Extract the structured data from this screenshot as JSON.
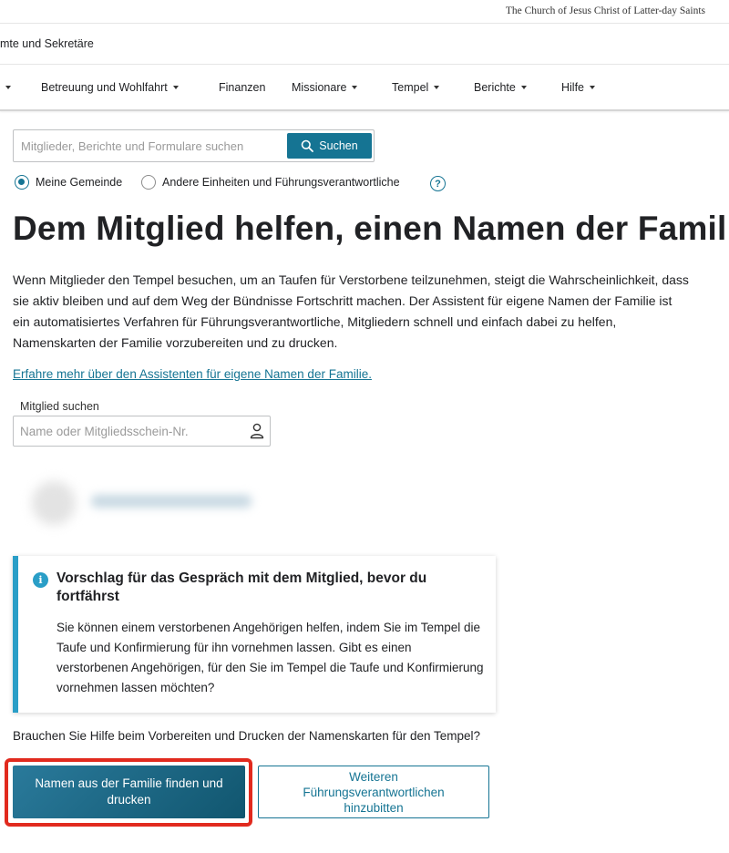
{
  "brand": "The Church of Jesus Christ of Latter-day Saints",
  "subheader": "mte und Sekretäre",
  "nav": {
    "items": [
      {
        "label": "",
        "has_caret": true
      },
      {
        "label": "Betreuung und Wohlfahrt",
        "has_caret": true
      },
      {
        "label": "Finanzen",
        "has_caret": false
      },
      {
        "label": "Missionare",
        "has_caret": true
      },
      {
        "label": "Tempel",
        "has_caret": true
      },
      {
        "label": "Berichte",
        "has_caret": true
      },
      {
        "label": "Hilfe",
        "has_caret": true
      }
    ]
  },
  "search": {
    "placeholder": "Mitglieder, Berichte und Formulare suchen",
    "button_label": "Suchen",
    "icon": "magnifier-icon"
  },
  "scope": {
    "options": [
      {
        "label": "Meine Gemeinde",
        "selected": true
      },
      {
        "label": "Andere Einheiten und Führungsverantwortliche",
        "selected": false
      }
    ],
    "help_glyph": "?"
  },
  "page_title": "Dem Mitglied helfen, einen Namen der Familie",
  "intro": "Wenn Mitglieder den Tempel besuchen, um an Taufen für Verstorbene teilzunehmen, steigt die Wahrscheinlichkeit, dass sie aktiv bleiben und auf dem Weg der Bündnisse Fortschritt machen. Der Assistent für eigene Namen der Familie ist ein automatisiertes Verfahren für Führungsverantwortliche, Mitgliedern schnell und einfach dabei zu helfen, Namenskarten der Familie vorzubereiten und zu drucken.",
  "learn_more_link": "Erfahre mehr über den Assistenten für eigene Namen der Familie.",
  "member_search": {
    "label": "Mitglied suchen",
    "placeholder": "Name oder Mitgliedsschein-Nr.",
    "icon": "person-icon"
  },
  "callout": {
    "icon_glyph": "i",
    "title": "Vorschlag für das Gespräch mit dem Mitglied, bevor du fortfährst",
    "body": "Sie können einem verstorbenen Angehörigen helfen, indem Sie im Tempel die Taufe und Konfirmierung für ihn vornehmen lassen. Gibt es einen verstorbenen Angehörigen, für den Sie im Tempel die Taufe und Konfirmierung vornehmen lassen möchten?"
  },
  "help_question": "Brauchen Sie Hilfe beim Vorbereiten und Drucken der Namenskarten für den Tempel?",
  "actions": {
    "primary_label": "Namen aus der Familie finden und drucken",
    "secondary_label": "Weiteren Führungsverantwortlichen hinzubitten"
  },
  "colors": {
    "accent": "#157493",
    "info": "#2a9ec7",
    "highlight": "#e12a1e"
  }
}
